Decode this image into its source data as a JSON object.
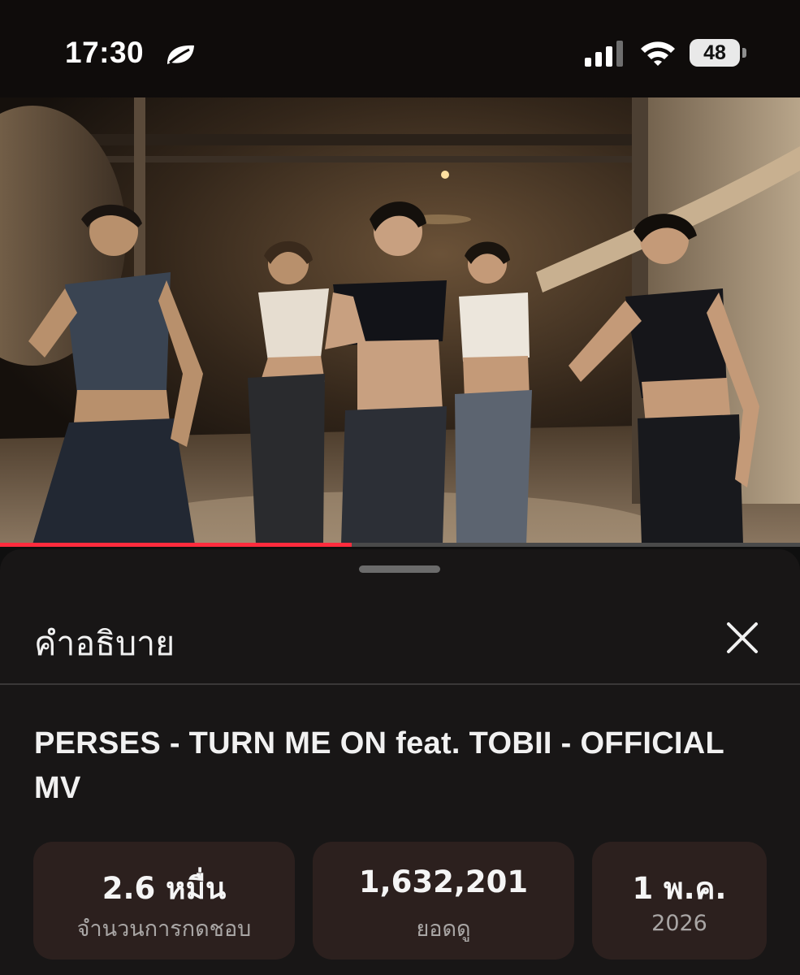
{
  "status_bar": {
    "time": "17:30",
    "battery": "48",
    "icons": [
      "leaf-icon",
      "cellular-signal-icon",
      "wifi-icon",
      "battery-icon"
    ]
  },
  "video": {
    "thumbnail": "music-video-frame",
    "progress_fraction": 0.44
  },
  "description_panel": {
    "heading": "คำอธิบาย",
    "close_icon": "close-icon",
    "title": "PERSES - TURN ME ON feat. TOBII - OFFICIAL MV",
    "stats": {
      "likes": {
        "value": "2.6 หมื่น",
        "label": "จำนวนการกดชอบ"
      },
      "views": {
        "value": "1,632,201",
        "label": "ยอดดู"
      },
      "date": {
        "value": "1 พ.ค.",
        "label": "2026"
      }
    }
  },
  "colors": {
    "background": "#0f0f0f",
    "sheet": "#181616",
    "stat_card": "#2c201e",
    "progress": "#ff2b3d"
  }
}
